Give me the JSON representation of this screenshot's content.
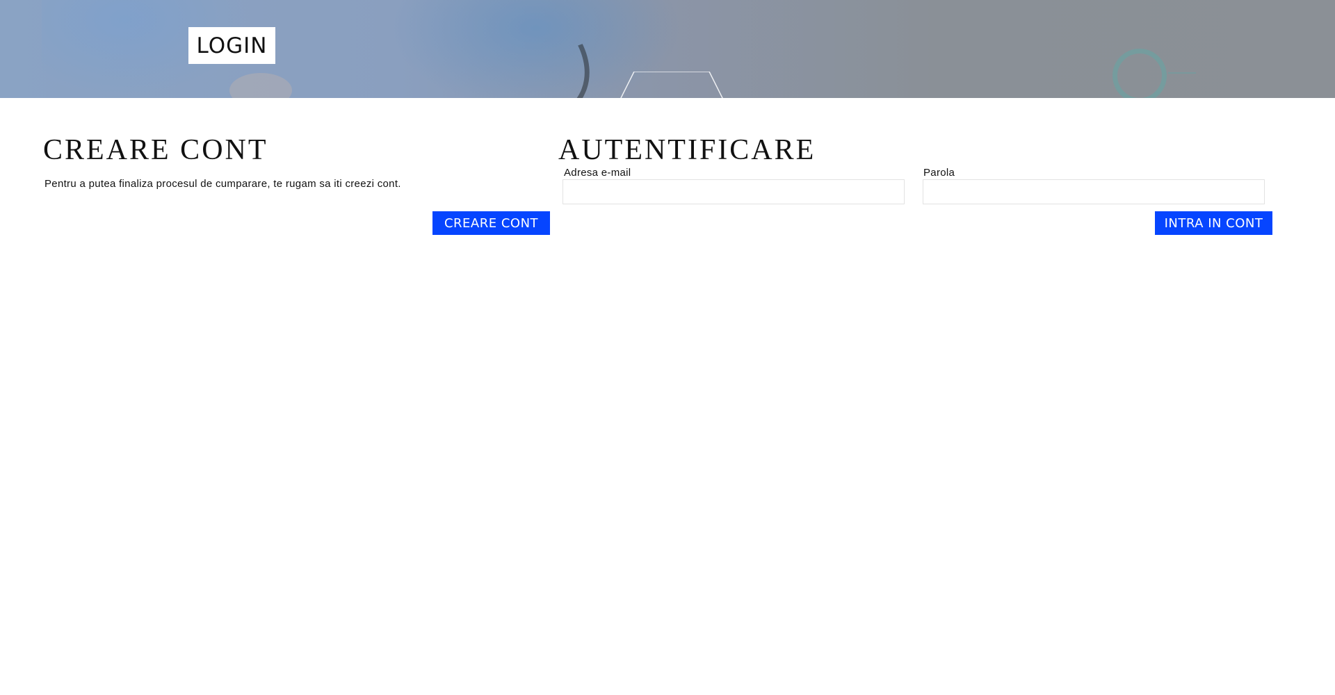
{
  "hero": {
    "badge": "LOGIN"
  },
  "create_account": {
    "title": "CREARE CONT",
    "description": "Pentru a putea finaliza procesul de cumparare, te rugam sa iti creezi cont.",
    "button_label": "CREARE CONT"
  },
  "authentication": {
    "title": "AUTENTIFICARE",
    "email": {
      "label": "Adresa e-mail",
      "value": "",
      "placeholder": ""
    },
    "password": {
      "label": "Parola",
      "value": "",
      "placeholder": ""
    },
    "button_label": "INTRA IN CONT"
  },
  "colors": {
    "primary_button": "#0645ff",
    "hero_overlay": "#8a98ae",
    "ring_accent": "#6ea0a0"
  }
}
